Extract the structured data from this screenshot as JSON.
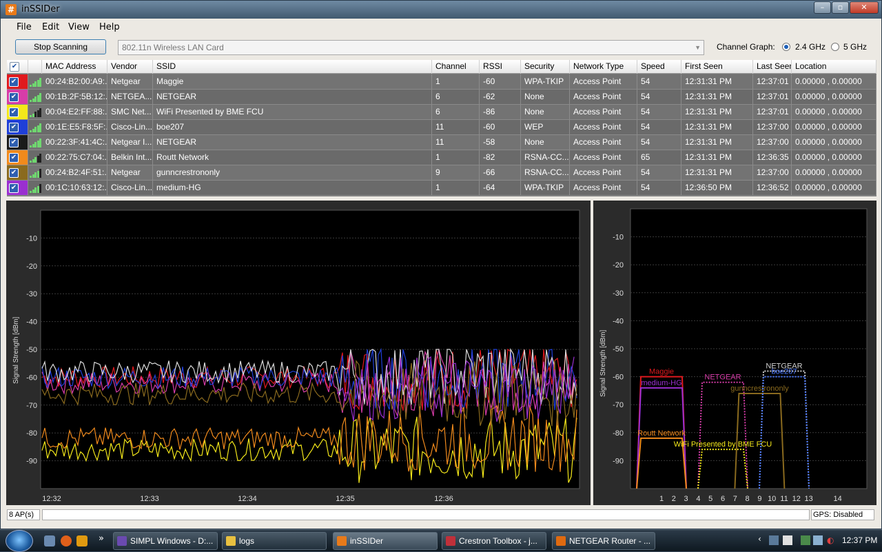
{
  "window": {
    "title": "inSSIDer",
    "app_icon": "#",
    "minimize": "–",
    "maximize": "▫",
    "close": "✕"
  },
  "menu": [
    "File",
    "Edit",
    "View",
    "Help"
  ],
  "toolbar": {
    "stop_label": "Stop Scanning",
    "adapter": "802.11n Wireless LAN Card",
    "channel_graph_label": "Channel Graph:",
    "band_24": "2.4 GHz",
    "band_5": "5 GHz",
    "selected_band": "2.4 GHz"
  },
  "table": {
    "columns": [
      "MAC Address",
      "Vendor",
      "SSID",
      "Channel",
      "RSSI",
      "Security",
      "Network Type",
      "Speed",
      "First Seen",
      "Last Seen",
      "Location"
    ],
    "rows": [
      {
        "color": "#e0191e",
        "mac": "00:24:B2:00:A9:...",
        "vendor": "Netgear",
        "ssid": "Maggie",
        "channel": "1",
        "rssi": "-60",
        "security": "WPA-TKIP",
        "type": "Access Point",
        "speed": "54",
        "first": "12:31:31 PM",
        "last": "12:37:01 PM",
        "location": "0.00000 , 0.00000",
        "bars": 5
      },
      {
        "color": "#d63ca8",
        "mac": "00:1B:2F:5B:12:...",
        "vendor": "NETGEA...",
        "ssid": "NETGEAR",
        "channel": "6",
        "rssi": "-62",
        "security": "None",
        "type": "Access Point",
        "speed": "54",
        "first": "12:31:31 PM",
        "last": "12:37:01 PM",
        "location": "0.00000 , 0.00000",
        "bars": 5
      },
      {
        "color": "#f4e81a",
        "mac": "00:04:E2:FF:88:...",
        "vendor": "SMC Net...",
        "ssid": "WiFi Presented by BME FCU",
        "channel": "6",
        "rssi": "-86",
        "security": "None",
        "type": "Access Point",
        "speed": "54",
        "first": "12:31:31 PM",
        "last": "12:37:01 PM",
        "location": "0.00000 , 0.00000",
        "bars": 2
      },
      {
        "color": "#1f3fd8",
        "mac": "00:1E:E5:F8:5F:...",
        "vendor": "Cisco-Lin...",
        "ssid": "boe207",
        "channel": "11",
        "rssi": "-60",
        "security": "WEP",
        "type": "Access Point",
        "speed": "54",
        "first": "12:31:31 PM",
        "last": "12:37:00 PM",
        "location": "0.00000 , 0.00000",
        "bars": 5
      },
      {
        "color": "#1a1a1a",
        "mac": "00:22:3F:41:4C:...",
        "vendor": "Netgear I...",
        "ssid": "NETGEAR",
        "channel": "11",
        "rssi": "-58",
        "security": "None",
        "type": "Access Point",
        "speed": "54",
        "first": "12:31:31 PM",
        "last": "12:37:00 PM",
        "location": "0.00000 , 0.00000",
        "bars": 5
      },
      {
        "color": "#f08a1c",
        "mac": "00:22:75:C7:04:...",
        "vendor": "Belkin Int...",
        "ssid": "Routt Network",
        "channel": "1",
        "rssi": "-82",
        "security": "RSNA-CC...",
        "type": "Access Point",
        "speed": "65",
        "first": "12:31:31 PM",
        "last": "12:36:35 PM",
        "location": "0.00000 , 0.00000",
        "bars": 3
      },
      {
        "color": "#8a6a1e",
        "mac": "00:24:B2:4F:51:...",
        "vendor": "Netgear",
        "ssid": "gunncrestrononly",
        "channel": "9",
        "rssi": "-66",
        "security": "RSNA-CC...",
        "type": "Access Point",
        "speed": "54",
        "first": "12:31:31 PM",
        "last": "12:37:00 PM",
        "location": "0.00000 , 0.00000",
        "bars": 4
      },
      {
        "color": "#9a2fd0",
        "mac": "00:1C:10:63:12:...",
        "vendor": "Cisco-Lin...",
        "ssid": "medium-HG",
        "channel": "1",
        "rssi": "-64",
        "security": "WPA-TKIP",
        "type": "Access Point",
        "speed": "54",
        "first": "12:36:50 PM",
        "last": "12:36:52 PM",
        "location": "0.00000 , 0.00000",
        "bars": 4
      }
    ]
  },
  "time_graph": {
    "ylabel": "Signal Strength [dBm]",
    "yticks": [
      "-10",
      "-20",
      "-30",
      "-40",
      "-50",
      "-60",
      "-70",
      "-80",
      "-90"
    ],
    "xticks": [
      "12:32",
      "12:33",
      "12:34",
      "12:35",
      "12:36"
    ]
  },
  "channel_graph": {
    "ylabel": "Signal Strength [dBm]",
    "yticks": [
      "-10",
      "-20",
      "-30",
      "-40",
      "-50",
      "-60",
      "-70",
      "-80",
      "-90"
    ],
    "xticks": [
      "1",
      "2",
      "3",
      "4",
      "5",
      "6",
      "7",
      "8",
      "9",
      "10",
      "11",
      "12",
      "13",
      "14"
    ],
    "networks": [
      {
        "label": "Maggie",
        "channel": 1,
        "rssi": -60,
        "color": "#e0191e",
        "dotted": false
      },
      {
        "label": "medium-HG",
        "channel": 1,
        "rssi": -64,
        "color": "#9a2fd0",
        "dotted": false
      },
      {
        "label": "Routt Network",
        "channel": 1,
        "rssi": -82,
        "color": "#f08a1c",
        "dotted": false
      },
      {
        "label": "NETGEAR",
        "channel": 6,
        "rssi": -62,
        "color": "#d63ca8",
        "dotted": true
      },
      {
        "label": "WiFi Presented by BME FCU",
        "channel": 6,
        "rssi": -86,
        "color": "#f4e81a",
        "dotted": true
      },
      {
        "label": "gunncrestrononly",
        "channel": 9,
        "rssi": -66,
        "color": "#8a6a1e",
        "dotted": false
      },
      {
        "label": "NETGEAR",
        "channel": 11,
        "rssi": -58,
        "color": "#cfcfcf",
        "dotted": true
      },
      {
        "label": "boe207",
        "channel": 11,
        "rssi": -60,
        "color": "#4a78ff",
        "dotted": true
      }
    ]
  },
  "status": {
    "ap_count": "8 AP(s)",
    "gps": "GPS: Disabled"
  },
  "taskbar": {
    "tasks": [
      {
        "label": "SIMPL Windows - D:...",
        "icon_color": "#6a4ab0",
        "active": false
      },
      {
        "label": "logs",
        "icon_color": "#e8c040",
        "active": false
      },
      {
        "label": "inSSIDer",
        "icon_color": "#e87a1a",
        "active": true
      },
      {
        "label": "Crestron Toolbox - j...",
        "icon_color": "#c0303a",
        "active": false
      },
      {
        "label": "NETGEAR Router - ...",
        "icon_color": "#e06a10",
        "active": false
      }
    ],
    "clock": "12:37 PM",
    "more": "»"
  }
}
